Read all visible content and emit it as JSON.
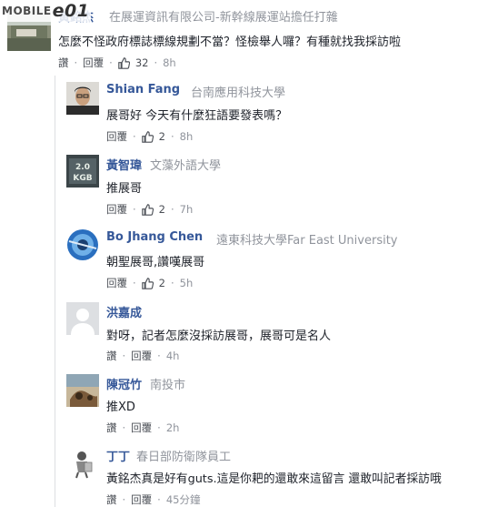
{
  "watermark": {
    "mobile": "MOBILE",
    "e01": "e01"
  },
  "main_comment": {
    "author": "黃銘杰",
    "affiliation": "在展運資訊有限公司-新幹線展運站擔任打雜",
    "text": "怎麼不怪政府標誌標線規劃不當？怪檢舉人囉？有種就找我採訪啦",
    "actions": {
      "like": "讚",
      "reply": "回覆",
      "likes": "32",
      "time": "8h"
    }
  },
  "replies": [
    {
      "author": "Shian Fang",
      "affiliation": "台南應用科技大學",
      "text": "展哥好 今天有什麼狂語要發表嗎？",
      "actions": {
        "reply": "回覆",
        "likes": "2",
        "time": "8h"
      }
    },
    {
      "author": "黃智瑋",
      "affiliation": "文藻外語大學",
      "text": "推展哥",
      "actions": {
        "reply": "回覆",
        "likes": "2",
        "time": "7h"
      },
      "avatar_text": {
        "top": "2.0",
        "bottom": "KGB"
      }
    },
    {
      "author": "Bo Jhang Chen",
      "affiliation": "遠東科技大學Far East University",
      "text": "朝聖展哥,讚嘆展哥",
      "actions": {
        "reply": "回覆",
        "likes": "2",
        "time": "5h"
      }
    },
    {
      "author": "洪嘉成",
      "affiliation": "",
      "text": "對呀，記者怎麼沒採訪展哥，展哥可是名人",
      "actions": {
        "like": "讚",
        "reply": "回覆",
        "time": "4h"
      }
    },
    {
      "author": "陳冠竹",
      "affiliation": "南投市",
      "text": "推XD",
      "actions": {
        "like": "讚",
        "reply": "回覆",
        "time": "2h"
      }
    },
    {
      "author": "丁丁",
      "affiliation": "春日部防衛隊員工",
      "text": "黃銘杰真是好有guts.這是你耙的還敢來這留言 還敢叫記者採訪哦",
      "actions": {
        "like": "讚",
        "reply": "回覆",
        "time": "45分鐘"
      }
    }
  ],
  "colors": {
    "name": "#365899",
    "meta": "#90949c",
    "text": "#1d2129",
    "thumb": "#4b4f56"
  },
  "icons": {
    "like": "thumbs-up-icon"
  }
}
